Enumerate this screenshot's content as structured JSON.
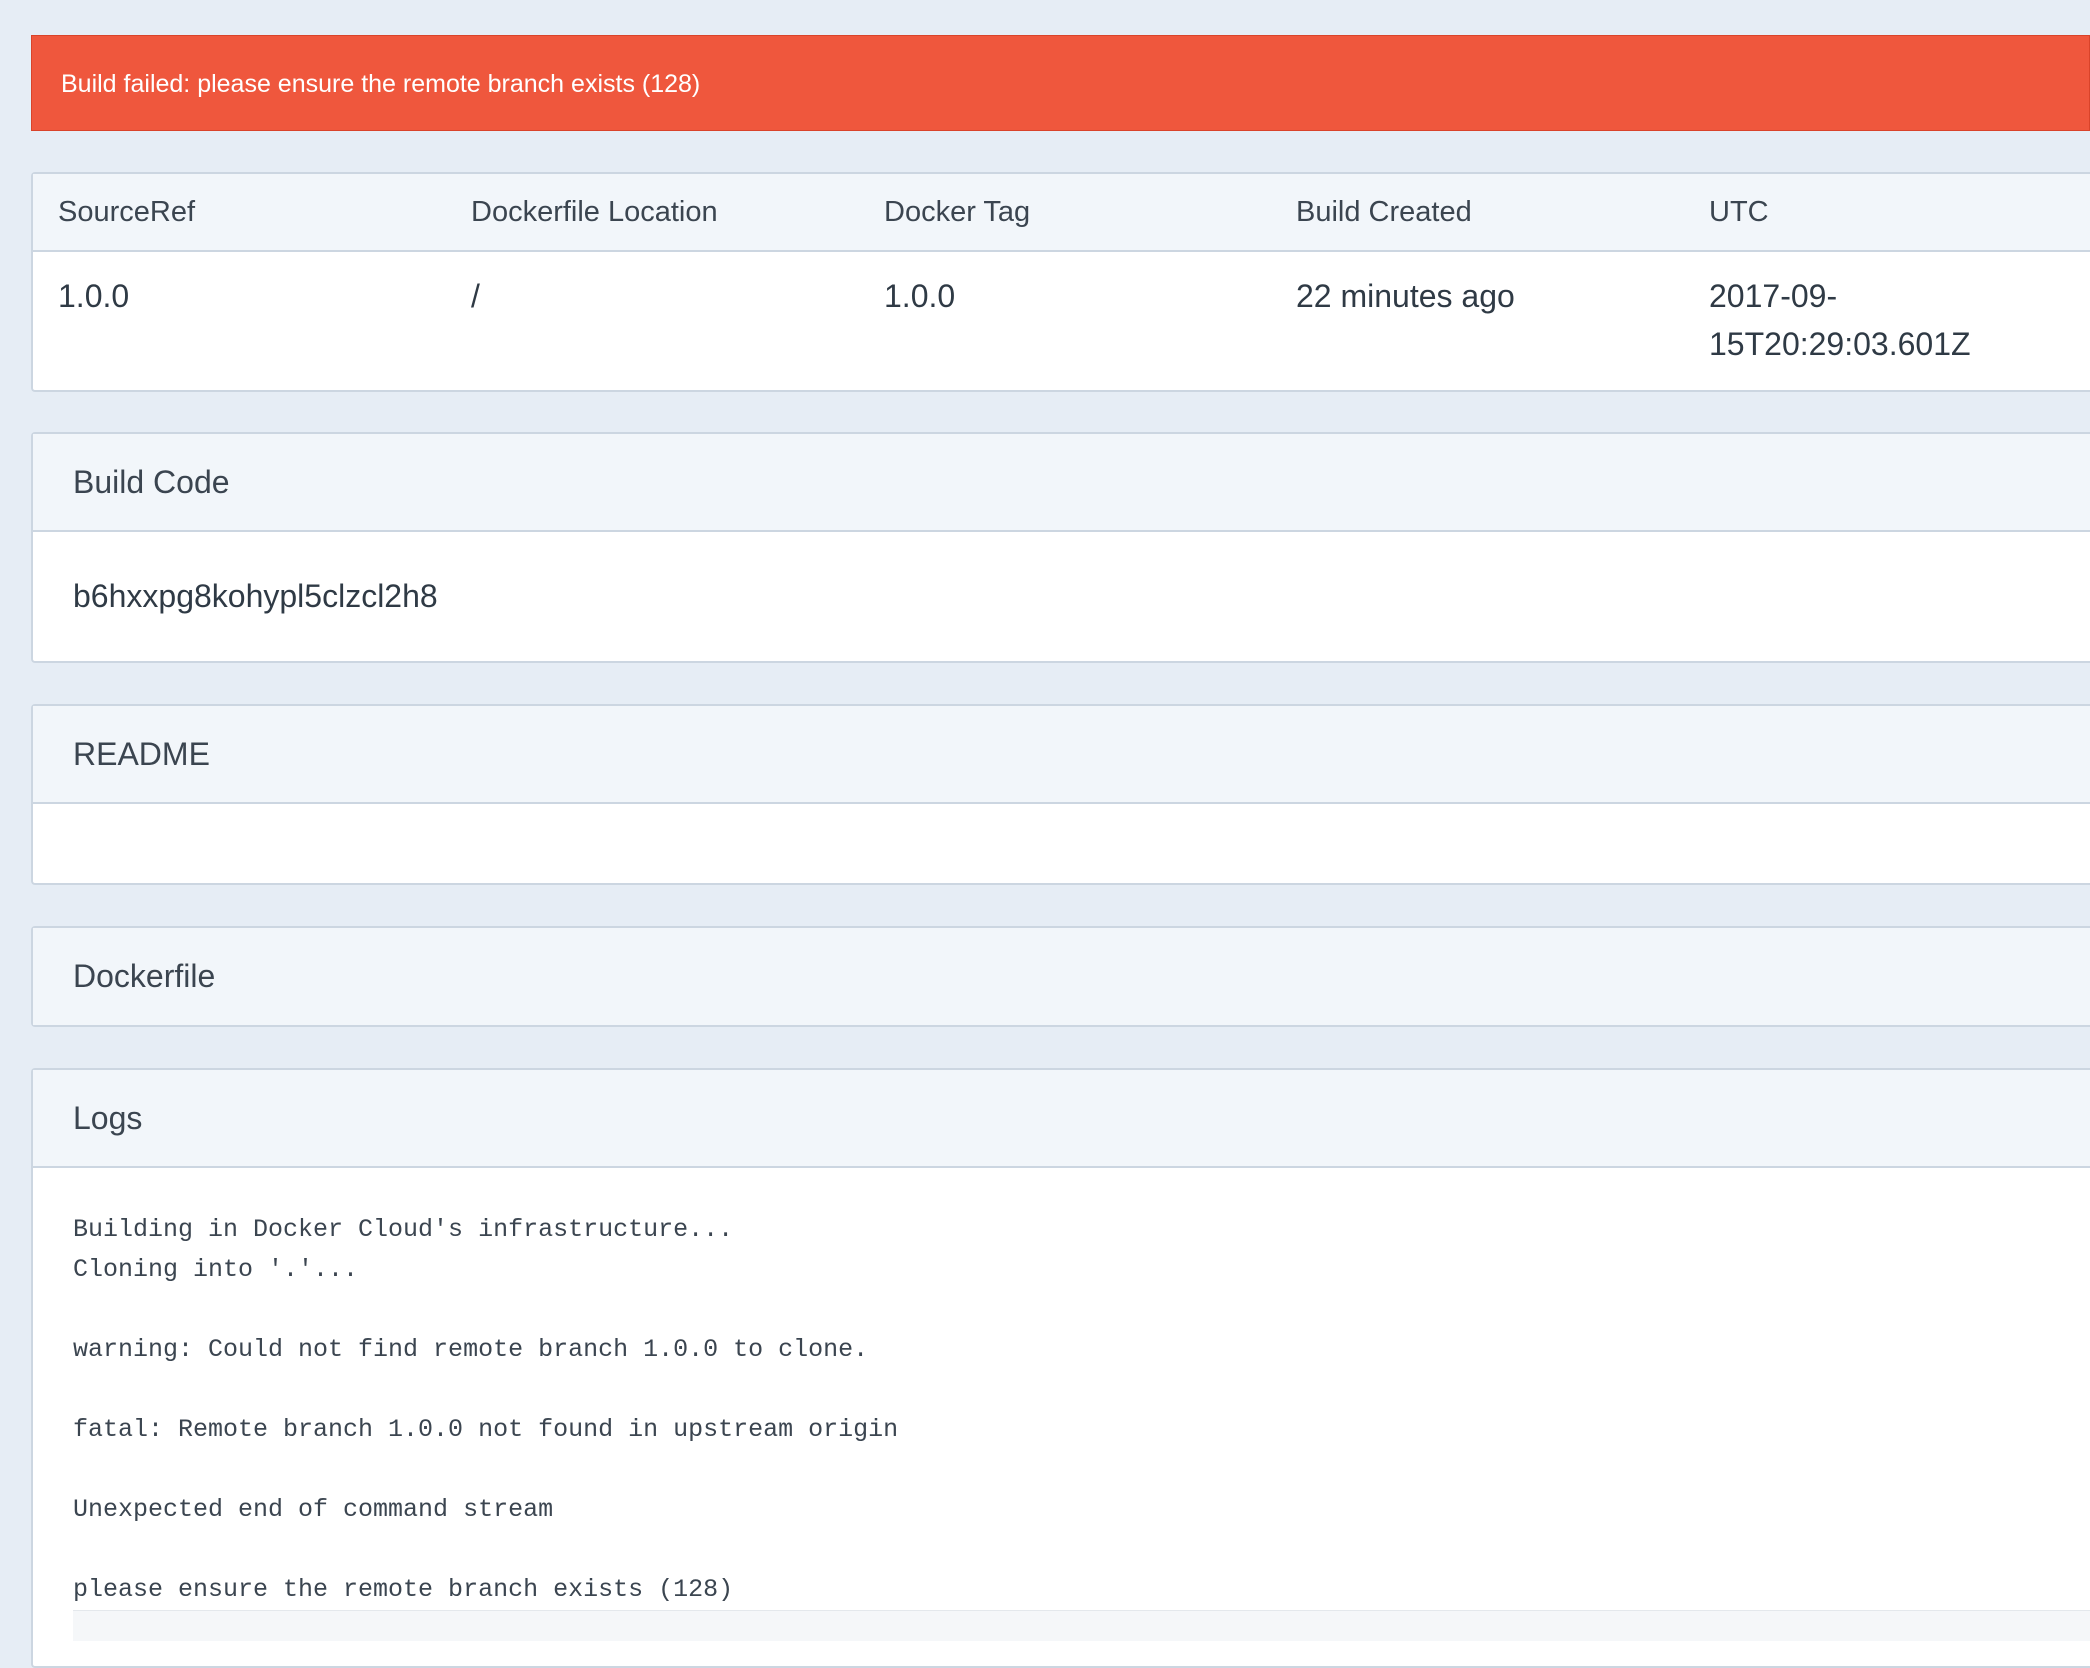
{
  "alert": {
    "message": "Build failed: please ensure the remote branch exists (128)",
    "color": "#ef573d"
  },
  "build_info": {
    "headers": [
      "SourceRef",
      "Dockerfile Location",
      "Docker Tag",
      "Build Created",
      "UTC"
    ],
    "values": [
      "1.0.0",
      "/",
      "1.0.0",
      "22 minutes ago",
      "2017-09-\n15T20:29:03.601Z"
    ],
    "utc_line1": "2017-09-",
    "utc_line2": "15T20:29:03.601Z"
  },
  "build_code": {
    "title": "Build Code",
    "value": "b6hxxpg8kohypl5clzcl2h8"
  },
  "readme": {
    "title": "README",
    "content": ""
  },
  "dockerfile": {
    "title": "Dockerfile"
  },
  "logs": {
    "title": "Logs",
    "lines": [
      "Building in Docker Cloud's infrastructure...",
      "Cloning into '.'...",
      "",
      "warning: Could not find remote branch 1.0.0 to clone.",
      "",
      "fatal: Remote branch 1.0.0 not found in upstream origin",
      "",
      "Unexpected end of command stream",
      "",
      "please ensure the remote branch exists (128)"
    ]
  }
}
